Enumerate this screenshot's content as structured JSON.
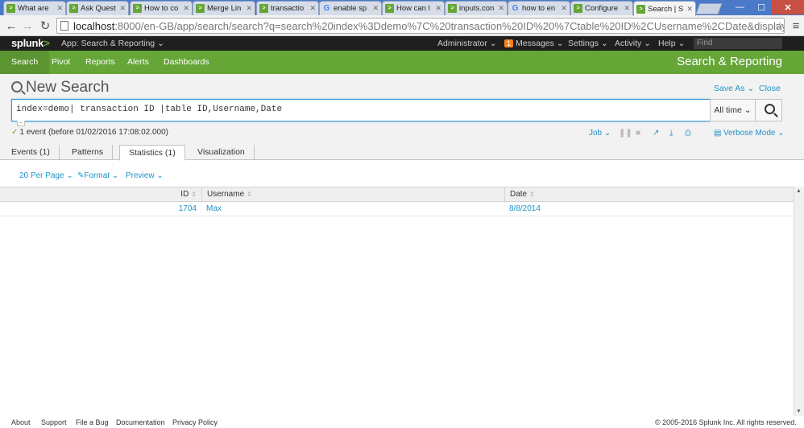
{
  "browser": {
    "tabs": [
      {
        "title": "What are",
        "favicon": "splunk-answers"
      },
      {
        "title": "Ask Quest",
        "favicon": "splunk-answers"
      },
      {
        "title": "How to co",
        "favicon": "splunk-answers"
      },
      {
        "title": "Merge Lin",
        "favicon": "splunk-answers"
      },
      {
        "title": "transactio",
        "favicon": "splunk-answers"
      },
      {
        "title": "enable sp",
        "favicon": "google"
      },
      {
        "title": "How can l",
        "favicon": "splunk-answers"
      },
      {
        "title": "inputs.con",
        "favicon": "splunk-answers"
      },
      {
        "title": "how to en",
        "favicon": "google"
      },
      {
        "title": "Configure",
        "favicon": "splunk-answers"
      },
      {
        "title": "Search | S",
        "favicon": "splunk-answers",
        "active": true
      }
    ],
    "url_host": "localhost",
    "url_rest": ":8000/en-GB/app/search/search?q=search%20index%3Ddemo%7C%20transaction%20ID%20%7Ctable%20ID%2CUsername%2CDate&display.page.search.mo"
  },
  "splunk_bar": {
    "logo": "splunk",
    "logo_mark": ">",
    "app_menu": "App: Search & Reporting ⌄",
    "user_menu": "Administrator ⌄",
    "messages_count": "1",
    "messages_label": "Messages ⌄",
    "settings": "Settings ⌄",
    "activity": "Activity ⌄",
    "help": "Help ⌄",
    "find_placeholder": "Find"
  },
  "app_bar": {
    "nav": [
      "Search",
      "Pivot",
      "Reports",
      "Alerts",
      "Dashboards"
    ],
    "title": "Search & Reporting"
  },
  "search": {
    "title": "New Search",
    "save_as": "Save As ⌄",
    "close": "Close",
    "query": "index=demo| transaction ID |table ID,Username,Date",
    "time_range": "All time ⌄",
    "event_count": "1 event (before 01/02/2016 17:08:02.000)",
    "job": "Job ⌄",
    "mode": "Verbose Mode ⌄"
  },
  "results_tabs": [
    "Events (1)",
    "Patterns",
    "Statistics (1)",
    "Visualization"
  ],
  "controls": {
    "per_page": "20 Per Page ⌄",
    "format": "Format ⌄",
    "preview": "Preview ⌄"
  },
  "table": {
    "columns": [
      "ID",
      "Username",
      "Date"
    ],
    "rows": [
      {
        "ID": "1704",
        "Username": "Max",
        "Date": "8/8/2014"
      }
    ]
  },
  "footer": {
    "links": [
      "About",
      "Support",
      "File a Bug",
      "Documentation",
      "Privacy Policy"
    ],
    "copyright": "© 2005-2016 Splunk Inc. All rights reserved."
  },
  "colors": {
    "splunk_green": "#65a637",
    "link_blue": "#1e93c6",
    "header_dark": "#1f1f1f",
    "chrome_blue": "#4a79c8"
  }
}
